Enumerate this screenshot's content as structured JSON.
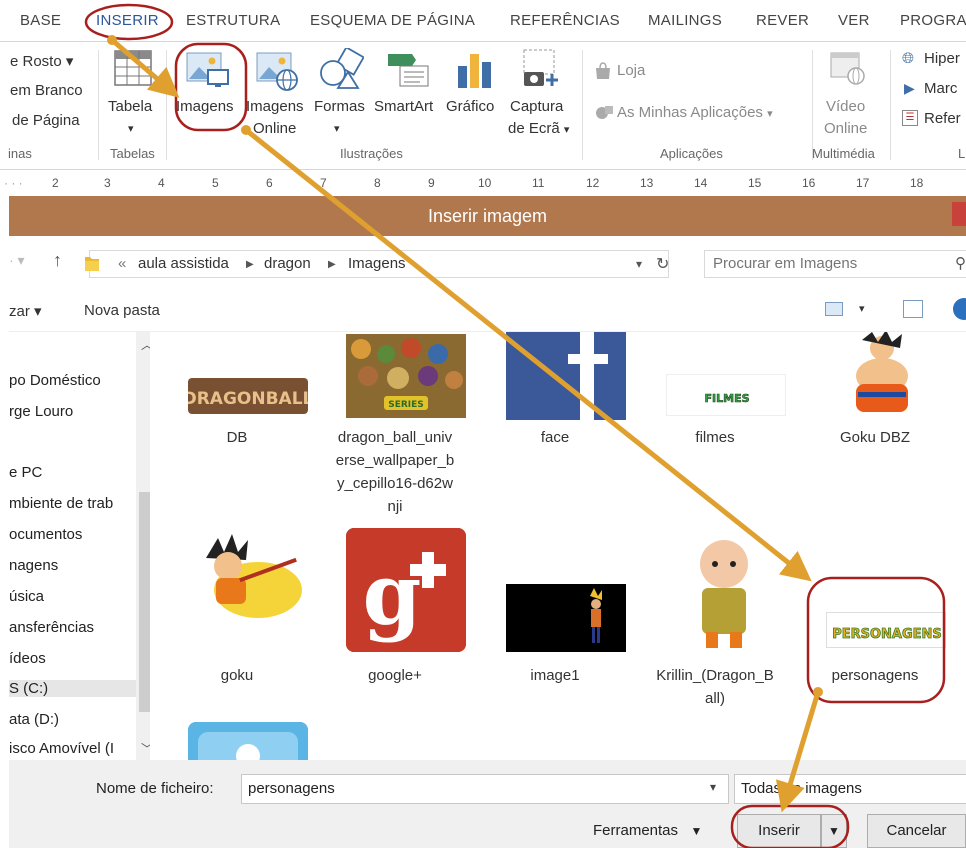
{
  "ribbon": {
    "tabs": [
      "BASE",
      "INSERIR",
      "ESTRUTURA",
      "ESQUEMA DE PÁGINA",
      "REFERÊNCIAS",
      "MAILINGS",
      "REVER",
      "VER",
      "PROGRA"
    ],
    "active_tab": "INSERIR",
    "pages_items": [
      "e Rosto",
      "em Branco",
      "de Página"
    ],
    "pages_group_label": "inas",
    "tabela_label": "Tabela",
    "tabelas_group_label": "Tabelas",
    "imagens_label": "Imagens",
    "imagens_online_label_1": "Imagens",
    "imagens_online_label_2": "Online",
    "formas_label": "Formas",
    "smartart_label": "SmartArt",
    "grafico_label": "Gráfico",
    "captura_label_1": "Captura",
    "captura_label_2": "de Ecrã",
    "ilustracoes_group_label": "Ilustrações",
    "loja_label": "Loja",
    "minhas_apps_label": "As Minhas Aplicações",
    "aplicacoes_group_label": "Aplicações",
    "video_label_1": "Vídeo",
    "video_label_2": "Online",
    "multimedia_group_label": "Multimédia",
    "hiper_label": "Hiper",
    "marca_label": "Marc",
    "refer_label": "Refer",
    "last_group_label": "L"
  },
  "ruler": [
    "2",
    "3",
    "4",
    "5",
    "6",
    "7",
    "8",
    "9",
    "10",
    "11",
    "12",
    "13",
    "14",
    "15",
    "16",
    "17",
    "18"
  ],
  "dialog": {
    "title": "Inserir imagem",
    "breadcrumb": [
      "«",
      "aula assistida",
      "dragon",
      "Imagens"
    ],
    "search_placeholder": "Procurar em Imagens",
    "organize_label": "zar ▾",
    "new_folder_label": "Nova pasta"
  },
  "nav": [
    "po Doméstico",
    "rge Louro",
    "e PC",
    "mbiente de trab",
    "ocumentos",
    "nagens",
    "úsica",
    "ansferências",
    "ídeos",
    "S (C:)",
    "ata (D:)",
    "isco Amovível (I"
  ],
  "files": [
    {
      "name": "DB"
    },
    {
      "name_lines": [
        "dragon_ball_univ",
        "erse_wallpaper_b",
        "y_cepillo16-d62w",
        "nji"
      ]
    },
    {
      "name": "face"
    },
    {
      "name": "filmes"
    },
    {
      "name": "Goku DBZ"
    },
    {
      "name": "goku"
    },
    {
      "name": "google+"
    },
    {
      "name": "image1"
    },
    {
      "name_lines": [
        "Krillin_(Dragon_B",
        "all)"
      ]
    },
    {
      "name": "personagens"
    }
  ],
  "thumb_text": {
    "db": "DRAGONBALL",
    "series": "SERIES",
    "filmes": "FILMES",
    "personagens": "PERSONAGENS"
  },
  "bottom": {
    "filename_label": "Nome de ficheiro:",
    "filename_value": "personagens",
    "filter_value": "Todas as imagens",
    "tools_label": "Ferramentas",
    "insert_label": "Inserir",
    "cancel_label": "Cancelar"
  },
  "colors": {
    "accent": "#2b579a",
    "title_bar": "#b0784c",
    "annotation_arrow": "#e0a030",
    "annotation_circle": "#a8201e"
  }
}
